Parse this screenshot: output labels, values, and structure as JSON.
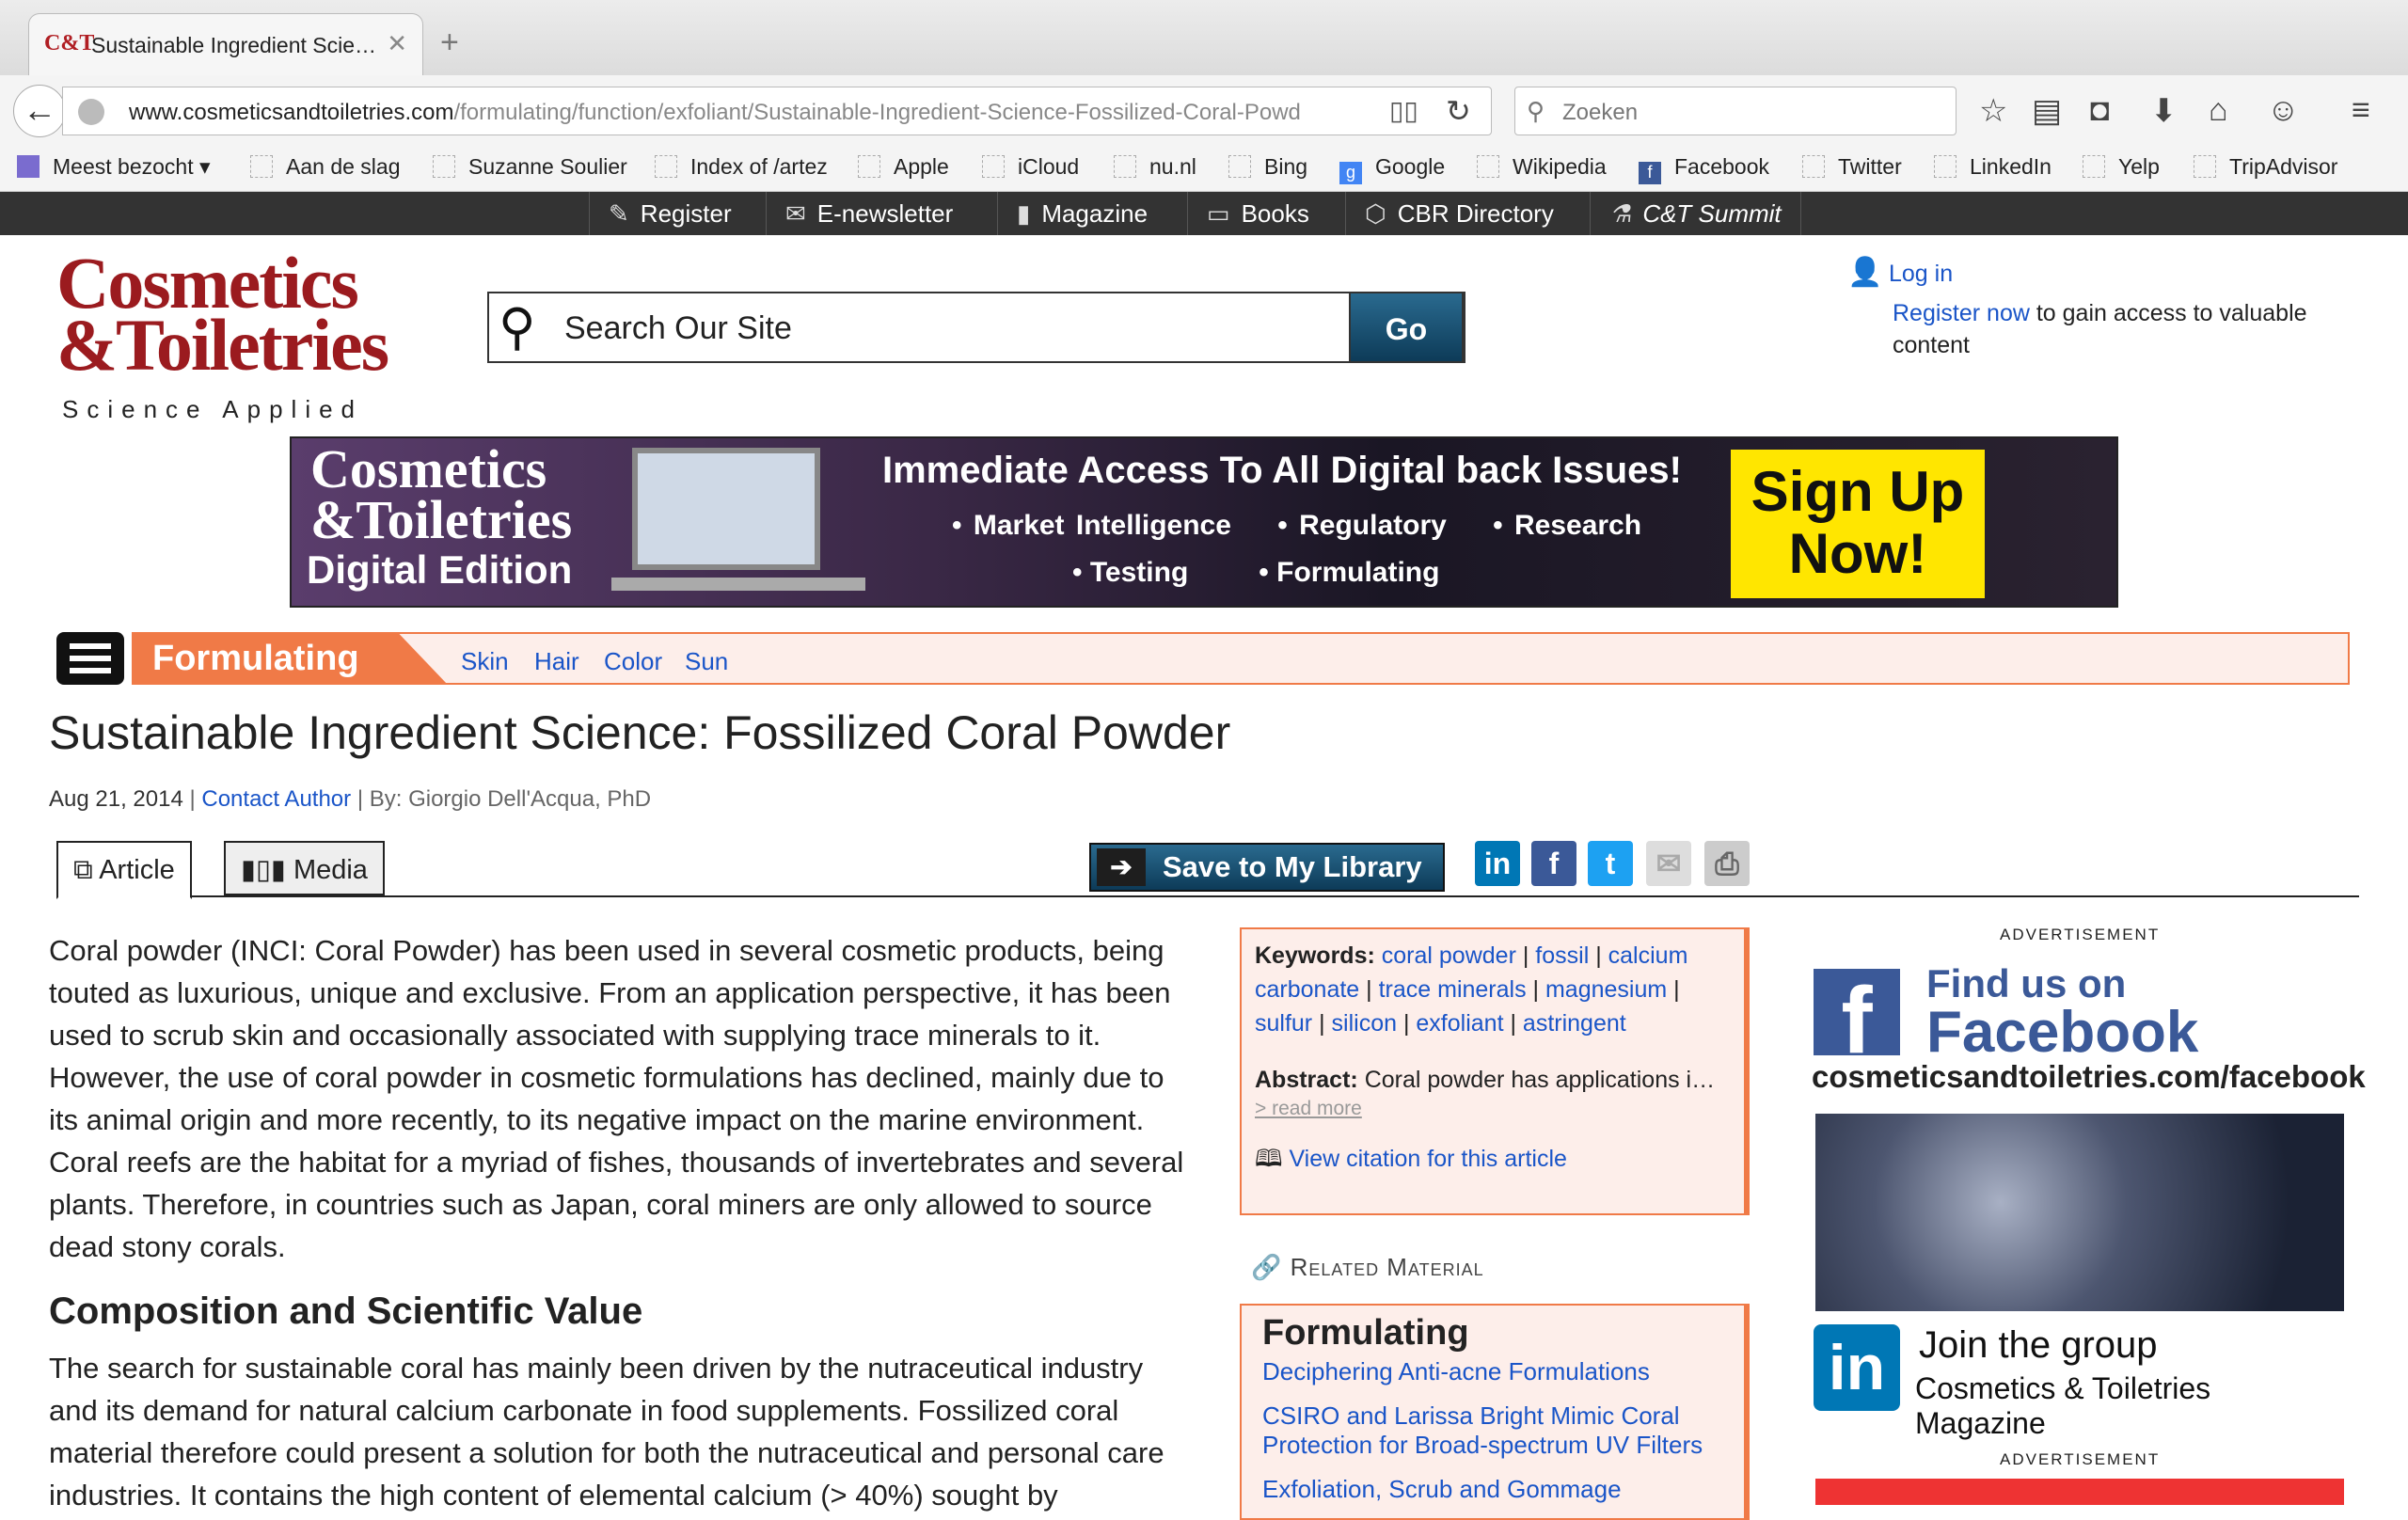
{
  "browser": {
    "tab_title": "Sustainable Ingredient Scie…",
    "tab_favicon": "C&T",
    "url_domain": "www.cosmeticsandtoiletries.com",
    "url_path": "/formulating/function/exfoliant/Sustainable-Ingredient-Science-Fossilized-Coral-Powd",
    "search_placeholder": "Zoeken",
    "bookmarks": [
      "Meest bezocht",
      "Aan de slag",
      "Suzanne Soulier",
      "Index of /artez",
      "Apple",
      "iCloud",
      "nu.nl",
      "Bing",
      "Google",
      "Wikipedia",
      "Facebook",
      "Twitter",
      "LinkedIn",
      "Yelp",
      "TripAdvisor"
    ]
  },
  "site_nav": [
    "Register",
    "E-newsletter",
    "Magazine",
    "Books",
    "CBR Directory",
    "C&T Summit"
  ],
  "header": {
    "logo_line1": "Cosmetics",
    "logo_line2": "&Toiletries",
    "logo_tagline": "Science Applied",
    "search_placeholder": "Search Our Site",
    "go_label": "Go",
    "login_label": "Log in",
    "register_link": "Register now",
    "register_text": " to gain access to valuable content"
  },
  "banner": {
    "brand1": "Cosmetics",
    "brand2": "&Toiletries",
    "brand3": "Digital Edition",
    "headline": "Immediate Access To All Digital back Issues!",
    "bullets_row1": "• Market Intelligence    • Regulatory    • Research",
    "bullets_row2": "• Testing         • Formulating",
    "cta1": "Sign Up",
    "cta2": "Now!"
  },
  "section": {
    "label": "Formulating",
    "links": [
      "Skin",
      "Hair",
      "Color",
      "Sun"
    ]
  },
  "article": {
    "title": "Sustainable Ingredient Science: Fossilized Coral Powder",
    "date": "Aug 21, 2014",
    "contact_author": "Contact Author",
    "byline": "By: Giorgio Dell'Acqua, PhD",
    "tab_article": "Article",
    "tab_media": "Media",
    "save_label": "Save to My Library",
    "paragraph1": "Coral powder (INCI: Coral Powder) has been used in several cosmetic products, being touted as luxurious, unique and exclusive. From an application perspective, it has been used to scrub skin and occasionally associated with supplying trace minerals to it. However, the use of coral powder in cosmetic formulations has declined, mainly due to its animal origin and more recently, to its negative impact on the marine environment. Coral reefs are the habitat for a myriad of fishes, thousands of invertebrates and several plants. Therefore, in countries such as Japan, coral miners are only allowed to source dead stony corals.",
    "heading2": "Composition and Scientific Value",
    "paragraph2": "The search for sustainable coral has mainly been driven by the nutraceutical industry and its demand for natural calcium carbonate in food supplements. Fossilized coral material therefore could present a solution for both the nutraceutical and personal care industries. It contains the high content of elemental calcium (> 40%) sought by"
  },
  "keywords_box": {
    "label": "Keywords:",
    "keywords": [
      "coral powder",
      "fossil",
      "calcium carbonate",
      "trace minerals",
      "magnesium",
      "sulfur",
      "silicon",
      "exfoliant",
      "astringent"
    ],
    "abstract_label": "Abstract:",
    "abstract_text": "Coral powder has applications i…",
    "read_more": "> read more",
    "citation": "View citation for this article"
  },
  "related": {
    "heading": "Related Material",
    "box_title": "Formulating",
    "links": [
      "Deciphering Anti-acne Formulations",
      "CSIRO and Larissa Bright Mimic Coral Protection for Broad-spectrum UV Filters",
      "Exfoliation, Scrub and Gommage"
    ]
  },
  "ads": {
    "label": "ADVERTISEMENT",
    "fb_line1": "Find us on",
    "fb_line2": "Facebook",
    "fb_url": "cosmeticsandtoiletries.com/facebook",
    "li_line1": "Join the group",
    "li_line2": "Cosmetics & Toiletries Magazine"
  },
  "colors": {
    "accent": "#f07a47",
    "brand": "#9b1b1f",
    "link": "#1a55c8"
  }
}
